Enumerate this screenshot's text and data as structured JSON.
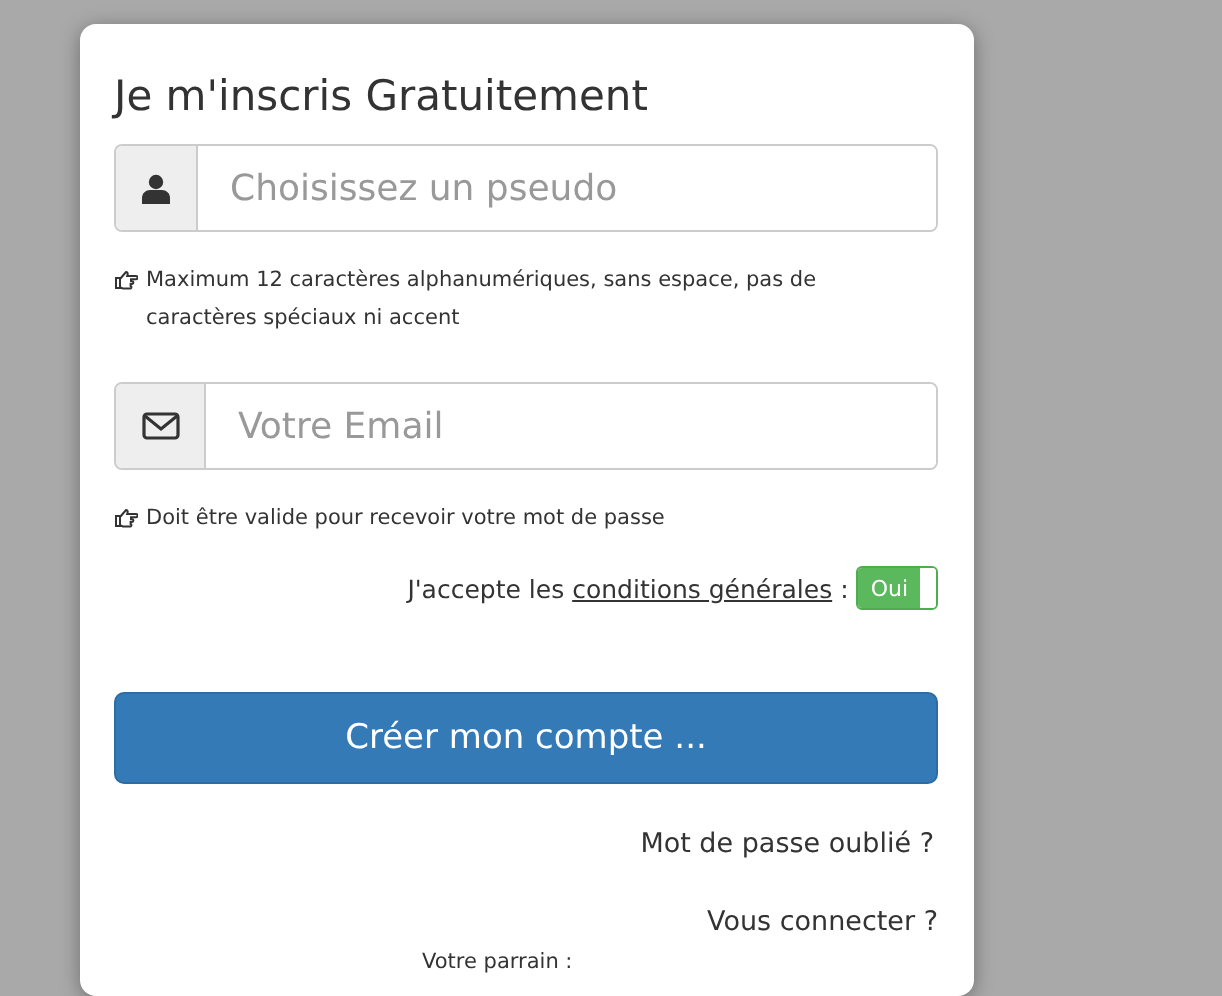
{
  "title": "Je m'inscris Gratuitement",
  "fields": [
    {
      "kind": "user",
      "placeholder": "Choisissez un pseudo",
      "hint": "Maximum 12 caractères alphanumériques, sans espace, pas de caractères spéciaux ni accent"
    },
    {
      "kind": "email",
      "placeholder": "Votre Email",
      "hint": "Doit être valide pour recevoir votre mot de passe"
    }
  ],
  "terms": {
    "prefix": "J'accepte les",
    "link": "conditions générales",
    "suffix": ":",
    "toggle": {
      "label": "Oui",
      "on": true
    }
  },
  "submit": "Créer mon compte ...",
  "links": [
    "Mot de passe oublié ?",
    "Vous connecter ?"
  ],
  "referrer_label": "Votre parrain :"
}
